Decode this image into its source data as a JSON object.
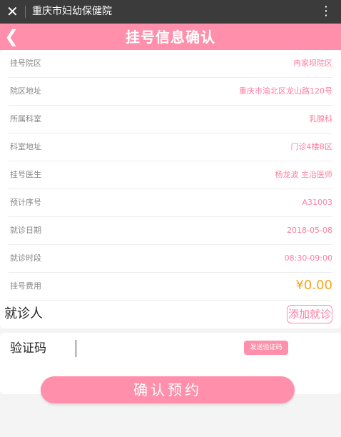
{
  "window": {
    "title": "重庆市妇幼保健院",
    "close_glyph": "✕",
    "more_glyph": "⋮"
  },
  "header": {
    "back_glyph": "❮",
    "title": "挂号信息确认"
  },
  "details": [
    {
      "label": "挂号院区",
      "value": "冉家坝院区"
    },
    {
      "label": "院区地址",
      "value": "重庆市渝北区龙山路120号"
    },
    {
      "label": "所属科室",
      "value": "乳腺科"
    },
    {
      "label": "科室地址",
      "value": "门诊4楼B区"
    },
    {
      "label": "挂号医生",
      "value": "杨龙波  主治医师"
    },
    {
      "label": "预计序号",
      "value": "A31003"
    },
    {
      "label": "就诊日期",
      "value": "2018-05-08"
    },
    {
      "label": "就诊时段",
      "value": "08:30-09:00"
    },
    {
      "label": "挂号费用",
      "value": "¥0.00"
    }
  ],
  "patient": {
    "label": "就诊人",
    "add_button": "添加就诊"
  },
  "verify": {
    "label": "验证码",
    "placeholder": "",
    "send_button": "发送验证码"
  },
  "confirm_button": "确认预约",
  "colors": {
    "accent": "#ff8fab",
    "fee": "#f5a623",
    "topbar": "#3b3b3b"
  }
}
